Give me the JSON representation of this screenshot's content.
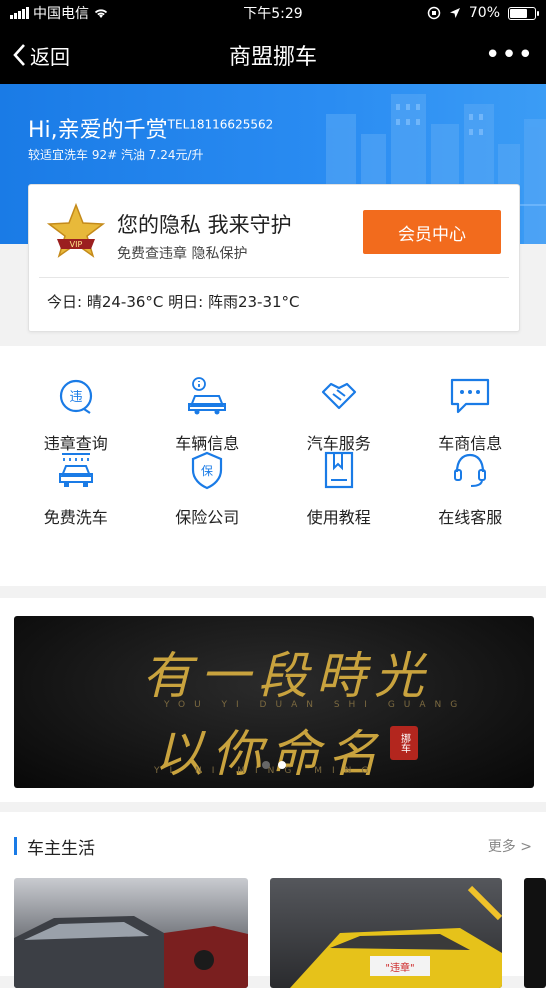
{
  "status_bar": {
    "carrier": "中国电信",
    "time": "下午5:29",
    "battery": "70%",
    "battery_level": 0.7
  },
  "navbar": {
    "back_label": "返回",
    "title": "商盟挪车",
    "more_label": "•••"
  },
  "hero": {
    "greeting": "Hi,亲爱的千赏",
    "tel": "TEL18116625562",
    "sub": "较适宜洗车  92# 汽油 7.24元/升"
  },
  "card": {
    "slogan": "您的隐私 我来守护",
    "desc": "免费查违章 隐私保护",
    "member_button": "会员中心",
    "weather": "今日: 晴24-36°C 明日: 阵雨23-31°C",
    "vip_badge": "VIP"
  },
  "services": [
    {
      "label": "违章查询",
      "icon": "violation-icon"
    },
    {
      "label": "车辆信息",
      "icon": "car-info-icon"
    },
    {
      "label": "汽车服务",
      "icon": "handshake-icon"
    },
    {
      "label": "车商信息",
      "icon": "chat-icon"
    },
    {
      "label": "免费洗车",
      "icon": "car-wash-icon"
    },
    {
      "label": "保险公司",
      "icon": "insurance-icon"
    },
    {
      "label": "使用教程",
      "icon": "book-icon"
    },
    {
      "label": "在线客服",
      "icon": "headset-icon"
    }
  ],
  "banner": {
    "line1": "有一段時光",
    "romanization1": "YOU YI DUAN SHI GUANG",
    "line2": "以你命名",
    "romanization2": "YI NI MING MING",
    "seal": "挪车",
    "slide_count": 2,
    "active_slide": 2
  },
  "life": {
    "title": "车主生活",
    "more": "更多 >"
  },
  "colors": {
    "accent": "#1a7be6",
    "orange": "#f26b1d"
  }
}
